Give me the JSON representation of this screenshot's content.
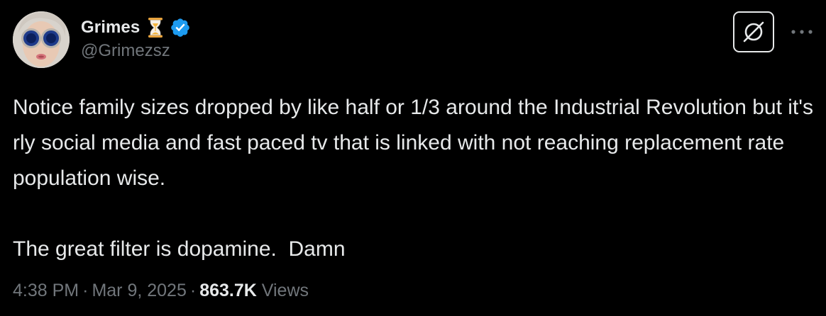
{
  "author": {
    "display_name": "Grimes",
    "handle": "@Grimezsz",
    "name_emoji": "hourglass-icon",
    "verified": true,
    "verified_color": "#1d9bf0"
  },
  "tweet": {
    "paragraphs": [
      "Notice family sizes dropped by like half or 1/3 around the Industrial Revolution but it's rly social media and fast paced tv that is linked with not reaching replacement rate population wise.",
      "The great filter is dopamine.  Damn"
    ]
  },
  "meta": {
    "time": "4:38 PM",
    "separator": "·",
    "date": "Mar 9, 2025",
    "views_count": "863.7K",
    "views_label": "Views"
  },
  "actions": {
    "grok_icon": "grok-icon",
    "more_icon": "more-icon"
  },
  "colors": {
    "background": "#000000",
    "text_primary": "#e7e9ea",
    "text_secondary": "#71767b"
  }
}
